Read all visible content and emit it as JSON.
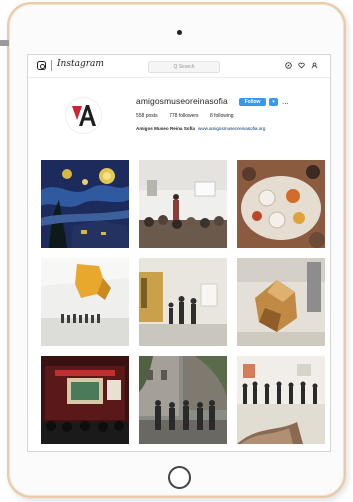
{
  "app": {
    "name": "Instagram"
  },
  "topbar": {
    "logo_text": "Instagram",
    "search_placeholder": "Q Search",
    "icons": [
      "compass-icon",
      "heart-icon",
      "user-icon"
    ]
  },
  "profile": {
    "username": "amigosmuseoreinasofia",
    "follow_label": "Follow",
    "more_label": "▾",
    "menu_label": "...",
    "stats": {
      "posts": "558 posts",
      "followers": "778 followers",
      "following": "8 following"
    },
    "bio_name": "Amigos Museo Reina Sofía",
    "bio_link": "www.amigosmuseoreinasofia.org"
  },
  "grid": {
    "posts": [
      {
        "name": "starry-night-painting",
        "colors": [
          "#1d2a5c",
          "#d8b840",
          "#2f5aa0"
        ]
      },
      {
        "name": "gallery-talk-room",
        "colors": [
          "#efefed",
          "#6b5a4c",
          "#b7b4ae"
        ]
      },
      {
        "name": "dinner-table-event",
        "colors": [
          "#cbbbab",
          "#d26c2a",
          "#8a5b3e"
        ]
      },
      {
        "name": "yellow-sculpture-hall",
        "colors": [
          "#efefed",
          "#e8a82d",
          "#5c5c5c"
        ]
      },
      {
        "name": "gallery-visitors-abstract",
        "colors": [
          "#e9e6df",
          "#c9a14a",
          "#3e3e3e"
        ]
      },
      {
        "name": "folded-sculpture",
        "colors": [
          "#e4e0d8",
          "#c08a45",
          "#8d8d8d"
        ]
      },
      {
        "name": "lecture-screen",
        "colors": [
          "#3a1212",
          "#c32f2f",
          "#1a1a1a"
        ]
      },
      {
        "name": "courtyard-group",
        "colors": [
          "#8a8c86",
          "#5a6b4a",
          "#2a2a2a"
        ]
      },
      {
        "name": "museum-crowd",
        "colors": [
          "#f1eee9",
          "#d47b5a",
          "#2a2a2a"
        ]
      }
    ]
  },
  "brand": {
    "red": "#d42030",
    "dark": "#1e1e1e",
    "blue": "#3897f0"
  }
}
